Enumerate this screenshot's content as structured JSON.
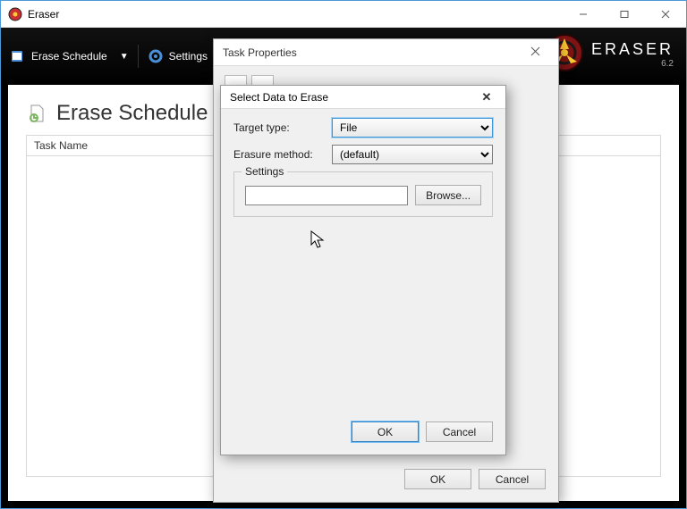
{
  "window": {
    "title": "Eraser"
  },
  "brand": {
    "name": "ERASER",
    "version": "6.2"
  },
  "toolbar": {
    "schedule_label": "Erase Schedule",
    "settings_label": "Settings"
  },
  "page": {
    "heading": "Erase Schedule",
    "column_task_name": "Task Name"
  },
  "task_dialog": {
    "title": "Task Properties",
    "ok": "OK",
    "cancel": "Cancel"
  },
  "select_dialog": {
    "title": "Select Data to Erase",
    "target_type_label": "Target type:",
    "target_type_value": "File",
    "target_type_options": [
      "File"
    ],
    "erasure_method_label": "Erasure method:",
    "erasure_method_value": "(default)",
    "erasure_method_options": [
      "(default)"
    ],
    "settings_legend": "Settings",
    "path_value": "",
    "browse": "Browse...",
    "ok": "OK",
    "cancel": "Cancel"
  }
}
